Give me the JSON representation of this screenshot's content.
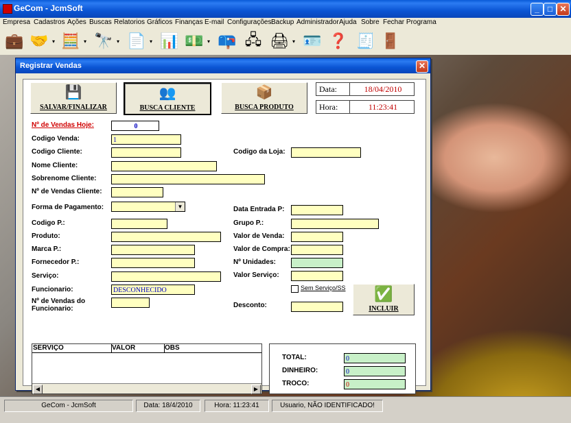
{
  "window": {
    "title": "GeCom - JcmSoft",
    "controls": [
      "_",
      "□",
      "✕"
    ]
  },
  "menu": [
    "Empresa",
    "Cadastros",
    "Ações",
    "Buscas",
    "Relatorios",
    "Gráficos",
    "Finanças",
    "E-mail",
    "Configurações",
    "Backup",
    "Administrador",
    "Ajuda",
    "Sobre",
    "Fechar Programa"
  ],
  "toolbar": [
    "briefcase-icon",
    "handshake-icon",
    "cash-register-icon",
    "binoculars-icon",
    "document-icon",
    "chart-icon",
    "money-icon",
    "mailbox-icon",
    "network-icon",
    "printer-icon",
    "user-card-icon",
    "help-icon",
    "calculator-icon",
    "exit-icon"
  ],
  "dialog": {
    "title": "Registrar Vendas",
    "buttons": {
      "save": "SALVAR/FINALIZAR",
      "client": "BUSCA CLIENTE",
      "product": "BUSCA PRODUTO",
      "include": "INCLUIR"
    },
    "date_label": "Data:",
    "date_value": "18/04/2010",
    "time_label": "Hora:",
    "time_value": "11:23:41",
    "fields": {
      "vendas_hoje_label": "Nº de Vendas Hoje:",
      "vendas_hoje_value": "0",
      "codigo_venda_label": "Codigo Venda:",
      "codigo_venda_value": "1",
      "codigo_cliente_label": "Codigo Cliente:",
      "codigo_loja_label": "Codigo da Loja:",
      "nome_cliente_label": "Nome Cliente:",
      "sobrenome_label": "Sobrenome Cliente:",
      "vendas_cliente_label": "Nº de Vendas Cliente:",
      "forma_pagamento_label": "Forma de Pagamento:",
      "data_entrada_label": "Data Entrada P:",
      "codigo_p_label": "Codigo P.:",
      "grupo_p_label": "Grupo P.:",
      "produto_label": "Produto:",
      "valor_venda_label": "Valor de Venda:",
      "marca_label": "Marca P.:",
      "valor_compra_label": "Valor de Compra:",
      "fornecedor_label": "Fornecedor P.:",
      "unidades_label": "Nº Unidades:",
      "servico_label": "Serviço:",
      "valor_servico_label": "Valor Serviço:",
      "funcionario_label": "Funcionario:",
      "funcionario_value": "DESCONHECIDO",
      "sem_servico_label": "Sem Serviço/SS",
      "vendas_func_label_1": "Nº de Vendas do",
      "vendas_func_label_2": "Funcionario:",
      "desconto_label": "Desconto:"
    },
    "grid": {
      "columns": [
        "SERVIÇO",
        "VALOR",
        "OBS"
      ]
    },
    "totals": {
      "total_label": "TOTAL:",
      "total_value": "0",
      "dinheiro_label": "DINHEIRO:",
      "dinheiro_value": "0",
      "troco_label": "TROCO:",
      "troco_value": "0"
    }
  },
  "status": {
    "app": "GeCom - JcmSoft",
    "date": "Data: 18/4/2010",
    "time": "Hora: 11:23:41",
    "user": "Usuario, NÃO IDENTIFICADO!"
  }
}
